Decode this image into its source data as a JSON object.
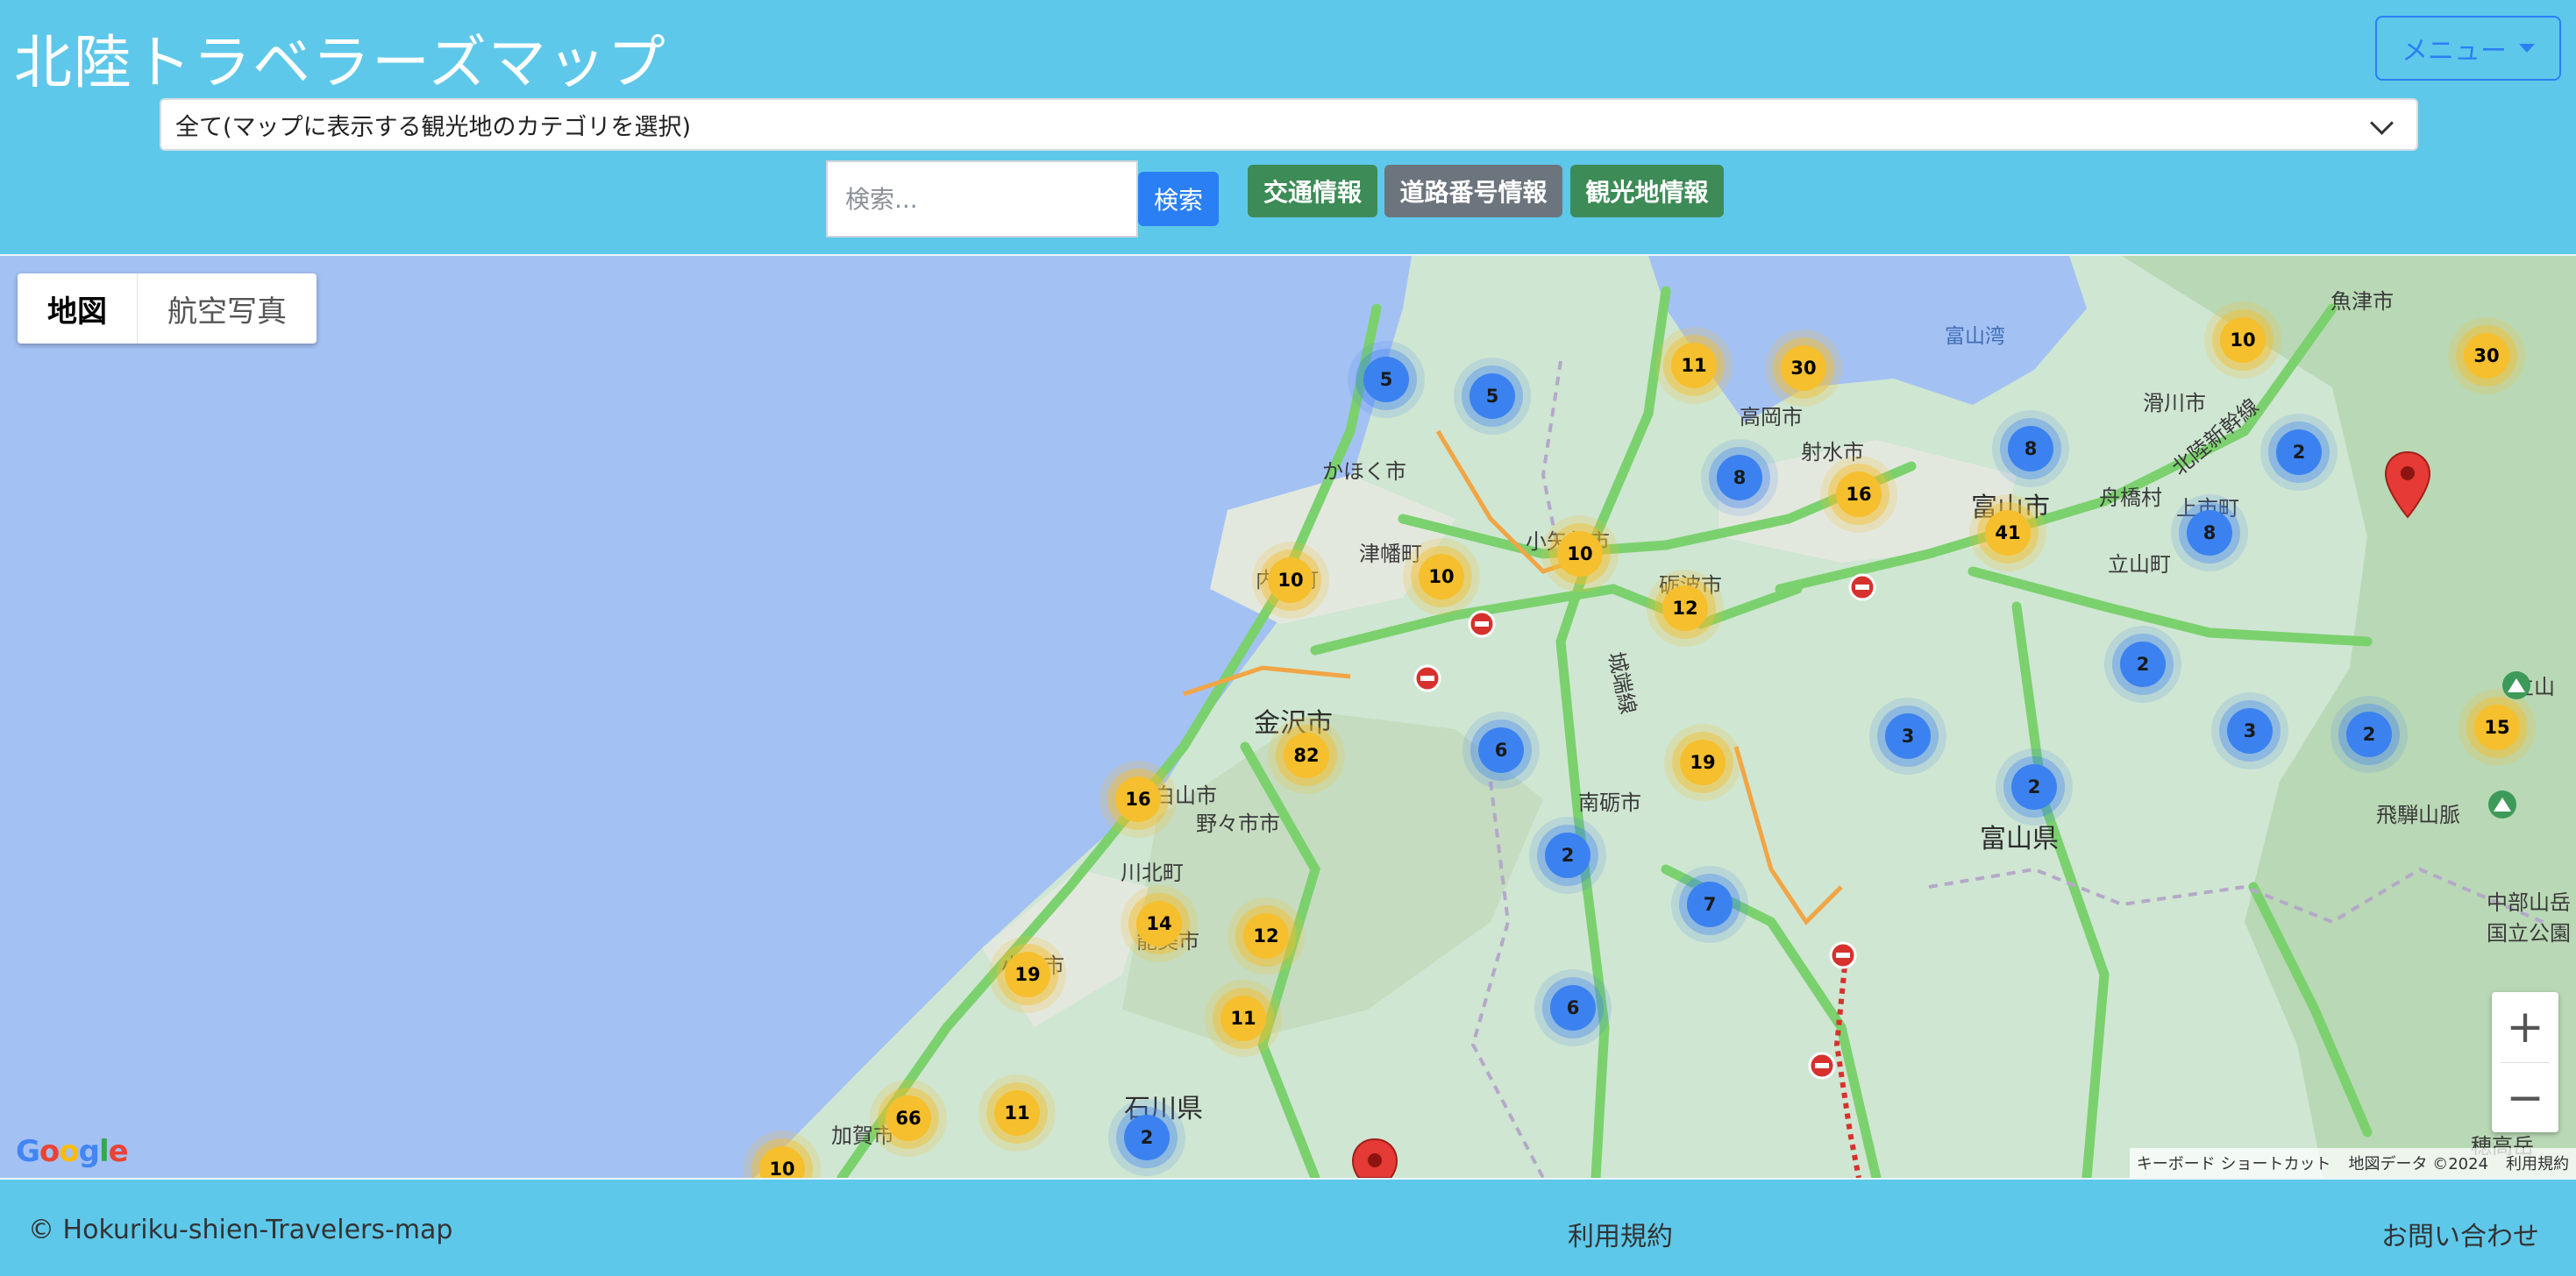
{
  "header": {
    "title": "北陸トラベラーズマップ",
    "menu_label": "メニュー",
    "category_select": "全て(マップに表示する観光地のカテゴリを選択)",
    "search_placeholder": "検索...",
    "search_button": "検索",
    "buttons": [
      "交通情報",
      "道路番号情報",
      "観光地情報"
    ]
  },
  "map": {
    "type_controls": [
      "地図",
      "航空写真"
    ],
    "zoom_in": "+",
    "zoom_out": "−",
    "logo": "Google",
    "attribution": [
      "キーボード ショートカット",
      "地図データ ©2024",
      "利用規約"
    ],
    "place_labels": [
      "富山湾",
      "滑川市",
      "かほく市",
      "高岡市",
      "射水市",
      "富山市",
      "舟橋村",
      "上市町",
      "津幡町",
      "小矢部市",
      "砺波市",
      "立山町",
      "内灘町",
      "金沢市",
      "白山市",
      "野々市市",
      "南砺市",
      "富山県",
      "川北町",
      "能美市",
      "小松市",
      "石川県",
      "加賀市",
      "飛騨山脈",
      "中部山岳国立公園",
      "魚津市",
      "城端線",
      "北陸新幹線",
      "立山",
      "穂高岳"
    ],
    "clusters": [
      {
        "label": "5",
        "color": "blue"
      },
      {
        "label": "5",
        "color": "blue"
      },
      {
        "label": "11",
        "color": "yellow"
      },
      {
        "label": "30",
        "color": "yellow"
      },
      {
        "label": "8",
        "color": "blue"
      },
      {
        "label": "16",
        "color": "yellow"
      },
      {
        "label": "8",
        "color": "blue"
      },
      {
        "label": "41",
        "color": "yellow"
      },
      {
        "label": "8",
        "color": "blue"
      },
      {
        "label": "2",
        "color": "blue"
      },
      {
        "label": "10",
        "color": "yellow"
      },
      {
        "label": "30",
        "color": "yellow"
      },
      {
        "label": "10",
        "color": "yellow"
      },
      {
        "label": "10",
        "color": "yellow"
      },
      {
        "label": "10",
        "color": "yellow"
      },
      {
        "label": "12",
        "color": "yellow"
      },
      {
        "label": "2",
        "color": "blue"
      },
      {
        "label": "3",
        "color": "blue"
      },
      {
        "label": "2",
        "color": "blue"
      },
      {
        "label": "15",
        "color": "yellow"
      },
      {
        "label": "6",
        "color": "blue"
      },
      {
        "label": "82",
        "color": "yellow"
      },
      {
        "label": "16",
        "color": "yellow"
      },
      {
        "label": "19",
        "color": "yellow"
      },
      {
        "label": "3",
        "color": "blue"
      },
      {
        "label": "2",
        "color": "blue"
      },
      {
        "label": "2",
        "color": "blue"
      },
      {
        "label": "14",
        "color": "yellow"
      },
      {
        "label": "12",
        "color": "yellow"
      },
      {
        "label": "19",
        "color": "yellow"
      },
      {
        "label": "7",
        "color": "blue"
      },
      {
        "label": "11",
        "color": "yellow"
      },
      {
        "label": "6",
        "color": "blue"
      },
      {
        "label": "66",
        "color": "yellow"
      },
      {
        "label": "11",
        "color": "yellow"
      },
      {
        "label": "2",
        "color": "blue"
      },
      {
        "label": "10",
        "color": "yellow"
      }
    ]
  },
  "footer": {
    "copyright": "© Hokuriku-shien-Travelers-map",
    "terms": "利用規約",
    "contact": "お問い合わせ"
  },
  "colors": {
    "header_bg": "#5ec8ea",
    "accent": "#2a7ff5",
    "traffic_green": "#3d8b57",
    "neutral_gray": "#6c757d",
    "sea": "#a4c1f4",
    "cluster_blue": "#3b82f0",
    "cluster_yellow": "#f5bf2e"
  }
}
